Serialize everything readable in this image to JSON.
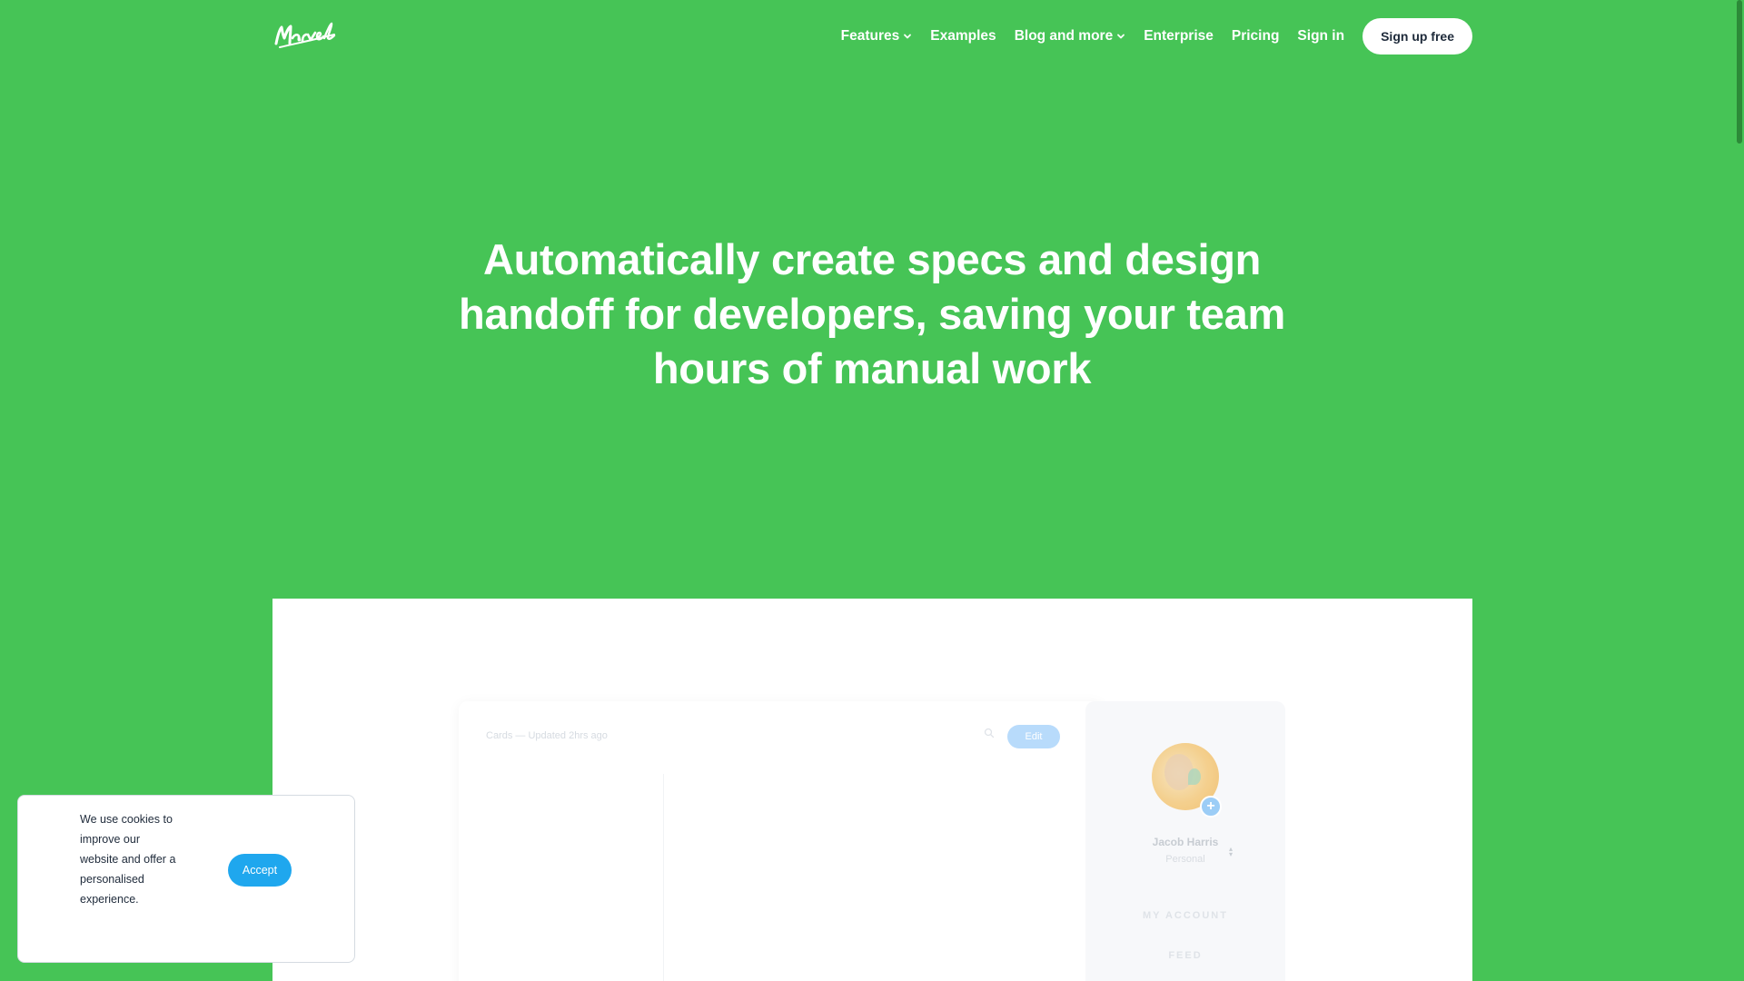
{
  "colors": {
    "background": "#46c456",
    "accent_button": "#1fa7ee",
    "text_dark": "#1e2a3a"
  },
  "header": {
    "logo_text": "Marvel",
    "nav": [
      {
        "label": "Features",
        "has_dropdown": true
      },
      {
        "label": "Examples",
        "has_dropdown": false
      },
      {
        "label": "Blog and more",
        "has_dropdown": true
      },
      {
        "label": "Enterprise",
        "has_dropdown": false
      },
      {
        "label": "Pricing",
        "has_dropdown": false
      },
      {
        "label": "Sign in",
        "has_dropdown": false
      }
    ],
    "cta_label": "Sign up free"
  },
  "hero": {
    "title": "Automatically create specs and design handoff for developers, saving your team hours of manual work"
  },
  "demo": {
    "status_text": "Cards — Updated 2hrs ago",
    "search_icon": "search-icon",
    "edit_label": "Edit",
    "profile": {
      "name": "Jacob Harris",
      "role": "Personal",
      "menu": [
        "MY ACCOUNT",
        "FEED"
      ]
    }
  },
  "cookie_banner": {
    "message": "We use cookies to improve our website and offer a personalised experience.",
    "accept_label": "Accept"
  }
}
